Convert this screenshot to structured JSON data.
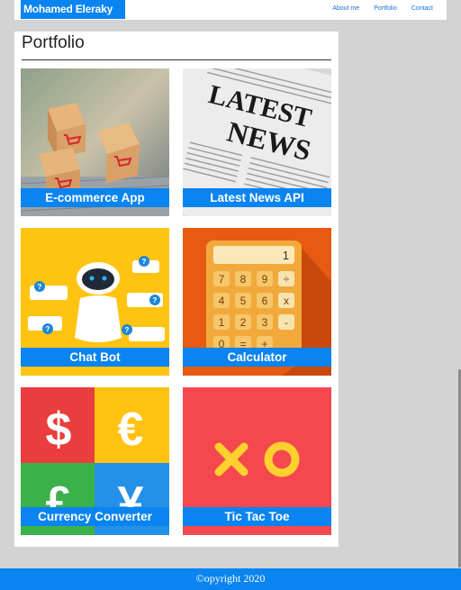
{
  "header": {
    "brand": "Mohamed Eleraky",
    "nav": [
      "About me",
      "Portfolio",
      "Contact"
    ]
  },
  "portfolio": {
    "title": "Portfolio",
    "projects": [
      {
        "label": "E-commerce App",
        "icon": "shopping-cart-boxes-image"
      },
      {
        "label": "Latest News API",
        "icon": "newspaper-image"
      },
      {
        "label": "Chat Bot",
        "icon": "robot-chat-image"
      },
      {
        "label": "Calculator",
        "icon": "calculator-image"
      },
      {
        "label": "Currency Converter",
        "icon": "currency-symbols-image"
      },
      {
        "label": "Tic Tac Toe",
        "icon": "x-o-image"
      }
    ],
    "image_text": {
      "news_headline_1": "LATEST",
      "news_headline_2": "NEWS",
      "calc_display": "1",
      "calc_keys": [
        "7",
        "8",
        "9",
        "÷",
        "4",
        "5",
        "6",
        "x",
        "1",
        "2",
        "3",
        "-",
        "0",
        "=",
        "+"
      ],
      "currency_symbols": [
        "$",
        "€",
        "£",
        "¥"
      ],
      "chat_bubble_mark": "?"
    }
  },
  "footer": {
    "text": "©opyright 2020"
  },
  "colors": {
    "accent": "#0a84f0",
    "background": "#d3d3d3",
    "tictactoe_bg": "#f5484e",
    "calculator_bg": "#e65a12",
    "chatbot_bg": "#ffc411"
  }
}
